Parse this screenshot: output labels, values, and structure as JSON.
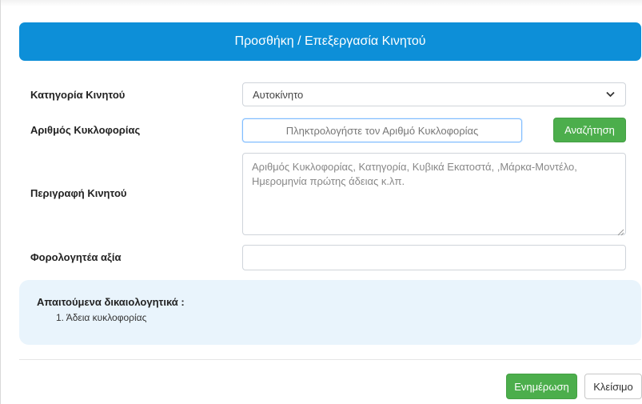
{
  "header": {
    "title": "Προσθήκη / Επεξεργασία Κινητού"
  },
  "form": {
    "category": {
      "label": "Κατηγορία Κινητού",
      "selected": "Αυτοκίνητο"
    },
    "plate": {
      "label": "Αριθμός Κυκλοφορίας",
      "placeholder": "Πληκτρολογήστε τον Αριθμό Κυκλοφορίας",
      "value": ""
    },
    "search_button": "Αναζήτηση",
    "description": {
      "label": "Περιγραφή Κινητού",
      "placeholder": "Αριθμός Κυκλοφορίας, Κατηγορία, Κυβικά Εκατοστά, ,Μάρκα-Μοντέλο, Ημερομηνία πρώτης άδειας κ.λπ."
    },
    "taxable_value": {
      "label": "Φορολογητέα αξία",
      "value": ""
    }
  },
  "required_docs": {
    "title": "Απαιτούμενα δικαιολογητικά :",
    "items": [
      "Άδεια κυκλοφορίας"
    ]
  },
  "footer": {
    "update_button": "Ενημέρωση",
    "close_button": "Κλείσιμο"
  },
  "colors": {
    "header_bg": "#0d8fd8",
    "success": "#4cae4c",
    "info_box_bg": "#e9f4fc"
  }
}
